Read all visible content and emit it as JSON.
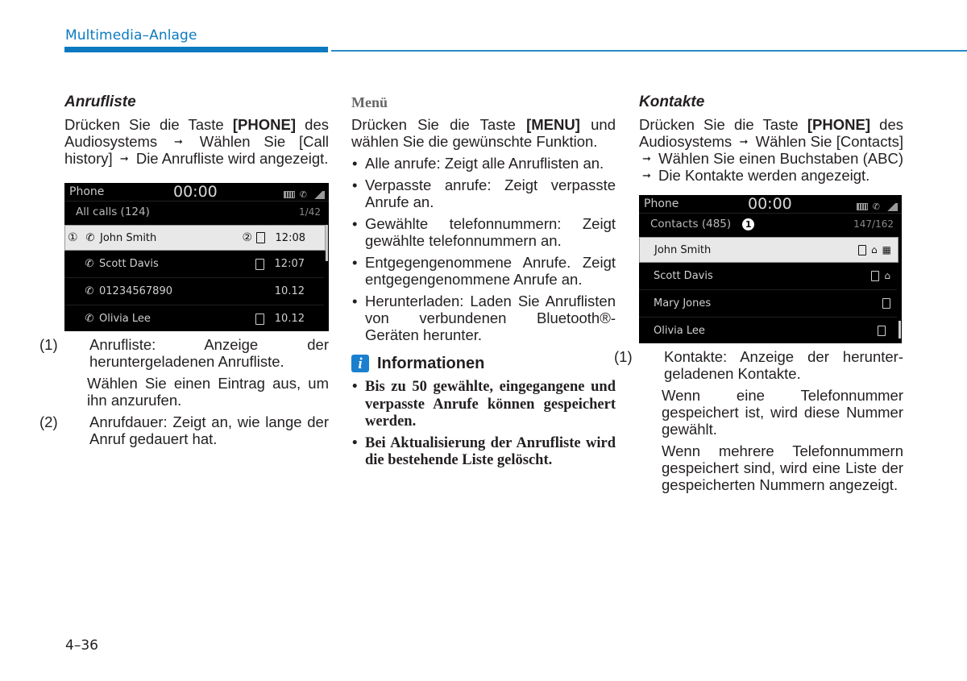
{
  "header": {
    "title": "Multimedia–Anlage"
  },
  "page_number": "4–36",
  "col1": {
    "heading": "Anrufliste",
    "intro": {
      "pre": "Drücken Sie die Taste ",
      "key": "[PHONE]",
      "post1": " des Audiosystems ",
      "arrow": "➞",
      "mid": " Wählen Sie [Call history] ",
      "post2": " Die Anrufliste wird angezeigt."
    },
    "screen": {
      "app": "Phone",
      "clock": "00:00",
      "subtitle": "All calls (124)",
      "page": "1/42",
      "rows": [
        {
          "marker1": "①",
          "name": "John Smith",
          "marker2": "②",
          "time": "12:08",
          "device": true,
          "call_type": "outgoing"
        },
        {
          "name": "Scott Davis",
          "time": "12:07",
          "device": true,
          "call_type": "outgoing"
        },
        {
          "name": "01234567890",
          "time": "10.12",
          "device": false,
          "call_type": "missed"
        },
        {
          "name": "Olivia Lee",
          "time": "10.12",
          "device": true,
          "call_type": "missed"
        }
      ]
    },
    "notes": [
      {
        "num": "(1)",
        "text": "Anrufliste: Anzeige der heruntergeladenen Anrufliste.",
        "sub": "Wählen Sie einen Eintrag aus, um ihn anzurufen."
      },
      {
        "num": "(2)",
        "text": "Anrufdauer: Zeigt an, wie lange der Anruf gedauert hat."
      }
    ]
  },
  "col2": {
    "heading": "Menü",
    "intro": {
      "pre": "Drücken Sie die Taste ",
      "key": "[MENU]",
      "post": " und wählen Sie die gewünschte Funktion."
    },
    "bullets": [
      "Alle anrufe: Zeigt alle Anruflisten an.",
      "Verpasste anrufe: Zeigt verpasste Anrufe an.",
      "Gewählte telefonnummern: Zeigt gewählte telefonnummern an.",
      "Entgegengenommene Anrufe. Zeigt entgegengenommene Anrufe an.",
      "Herunterladen: Laden Sie Anruflisten von verbundenen Bluetooth®-Geräten herunter."
    ],
    "info": {
      "icon": "i",
      "title": "Informationen",
      "items": [
        "Bis zu 50 gewählte, eingegangene und verpasste Anrufe können gespeichert werden.",
        "Bei Aktualisierung der Anrufliste wird die bestehende Liste gelöscht."
      ]
    }
  },
  "col3": {
    "heading": "Kontakte",
    "intro": {
      "pre": "Drücken Sie die Taste ",
      "key": "[PHONE]",
      "post1": " des Audiosystems ",
      "arrow": "➞",
      "mid1": " Wählen Sie [Contacts] ",
      "mid2": " Wählen Sie einen Buchstaben (ABC) ",
      "post2": " Die Kontakte werden angezeigt."
    },
    "screen": {
      "app": "Phone",
      "clock": "00:00",
      "subtitle": "Contacts (485)",
      "marker": "1",
      "page": "147/162",
      "rows": [
        {
          "name": "John Smith",
          "icons": [
            "mobile",
            "home",
            "office"
          ]
        },
        {
          "name": "Scott Davis",
          "icons": [
            "mobile",
            "home"
          ]
        },
        {
          "name": "Mary Jones",
          "icons": [
            "mobile"
          ]
        },
        {
          "name": "Olivia Lee",
          "icons": [
            "mobile"
          ]
        }
      ]
    },
    "notes": [
      {
        "num": "(1)",
        "text": "Kontakte: Anzeige der herunter-geladenen Kontakte.",
        "subs": [
          "Wenn eine Telefonnummer gespeichert ist, wird diese Nummer gewählt.",
          "Wenn mehrere Telefonnummern gespeichert sind, wird eine Liste der gespeicherten Nummern angezeigt."
        ]
      }
    ]
  }
}
